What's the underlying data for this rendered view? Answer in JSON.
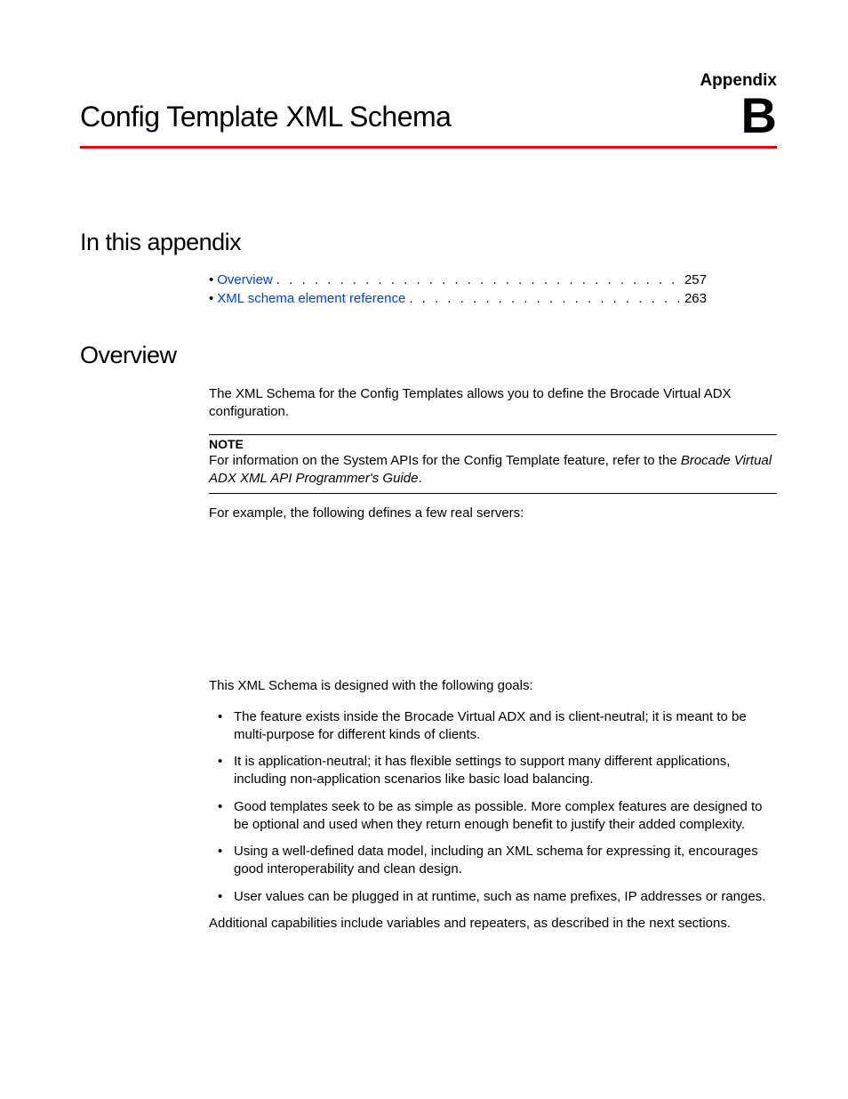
{
  "header": {
    "appendix_label": "Appendix",
    "appendix_letter": "B",
    "chapter_title": "Config Template XML Schema"
  },
  "section1": {
    "heading": "In this appendix",
    "toc": [
      {
        "label": "Overview",
        "page": "257"
      },
      {
        "label": "XML schema element reference",
        "page": "263"
      }
    ]
  },
  "section2": {
    "heading": "Overview",
    "intro": "The XML Schema for the Config Templates allows you to define the Brocade Virtual ADX configuration.",
    "note_label": "NOTE",
    "note_text_pre": "For information on the System APIs for the Config Template feature, refer to the ",
    "note_text_italic": "Brocade Virtual ADX XML API Programmer's Guide",
    "note_text_post": ".",
    "example_lead": "For example, the following defines a few real servers:",
    "goals_intro": "This XML Schema is designed with the following goals:",
    "goals": [
      "The feature exists inside the Brocade Virtual ADX and is client-neutral; it is meant to be multi-purpose for different kinds of clients.",
      "It is application-neutral; it has flexible settings to support many different applications, including non-application scenarios like basic load balancing.",
      "Good templates seek to be as simple as possible. More complex features are designed to be optional and used when they return enough benefit to justify their added complexity.",
      "Using a well-defined data model, including an XML schema for expressing it, encourages good interoperability and clean design.",
      "User values can be plugged in at runtime, such as name prefixes, IP addresses or ranges."
    ],
    "closing": "Additional capabilities include variables and repeaters, as described in the next sections."
  }
}
